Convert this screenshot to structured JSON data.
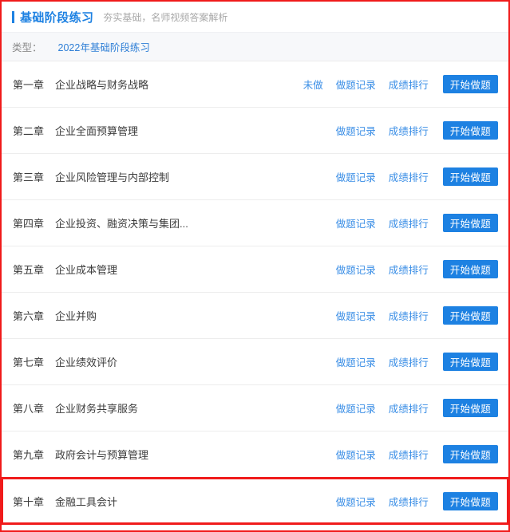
{
  "header": {
    "title": "基础阶段练习",
    "subtitle": "夯实基础，名师视频答案解析",
    "accent_color": "#1d81e2"
  },
  "filter": {
    "label": "类型：",
    "selected_option": "2022年基础阶段练习",
    "link_color": "#2f7fd6"
  },
  "list": {
    "labels": {
      "records": "做题记录",
      "ranking": "成绩排行",
      "start": "开始做题",
      "not_done": "未做"
    },
    "rows": [
      {
        "chapter": "第一章",
        "name": "企业战略与财务战略",
        "status": "未做",
        "records": "做题记录",
        "ranking": "成绩排行",
        "start": "开始做题",
        "highlighted": false
      },
      {
        "chapter": "第二章",
        "name": "企业全面预算管理",
        "status": "",
        "records": "做题记录",
        "ranking": "成绩排行",
        "start": "开始做题",
        "highlighted": false
      },
      {
        "chapter": "第三章",
        "name": "企业风险管理与内部控制",
        "status": "",
        "records": "做题记录",
        "ranking": "成绩排行",
        "start": "开始做题",
        "highlighted": false
      },
      {
        "chapter": "第四章",
        "name": "企业投资、融资决策与集团...",
        "status": "",
        "records": "做题记录",
        "ranking": "成绩排行",
        "start": "开始做题",
        "highlighted": false
      },
      {
        "chapter": "第五章",
        "name": "企业成本管理",
        "status": "",
        "records": "做题记录",
        "ranking": "成绩排行",
        "start": "开始做题",
        "highlighted": false
      },
      {
        "chapter": "第六章",
        "name": "企业并购",
        "status": "",
        "records": "做题记录",
        "ranking": "成绩排行",
        "start": "开始做题",
        "highlighted": false
      },
      {
        "chapter": "第七章",
        "name": "企业绩效评价",
        "status": "",
        "records": "做题记录",
        "ranking": "成绩排行",
        "start": "开始做题",
        "highlighted": false
      },
      {
        "chapter": "第八章",
        "name": "企业财务共享服务",
        "status": "",
        "records": "做题记录",
        "ranking": "成绩排行",
        "start": "开始做题",
        "highlighted": false
      },
      {
        "chapter": "第九章",
        "name": "政府会计与预算管理",
        "status": "",
        "records": "做题记录",
        "ranking": "成绩排行",
        "start": "开始做题",
        "highlighted": false
      },
      {
        "chapter": "第十章",
        "name": "金融工具会计",
        "status": "",
        "records": "做题记录",
        "ranking": "成绩排行",
        "start": "开始做题",
        "highlighted": true
      }
    ]
  },
  "colors": {
    "primary_blue": "#1d81e2",
    "link_blue": "#3a8ee6",
    "annotation_red": "#f01b1b",
    "filter_bg": "#f7f8fa",
    "divider": "#ededed",
    "text": "#3b3b3b",
    "muted_text": "#8c8c8c"
  }
}
